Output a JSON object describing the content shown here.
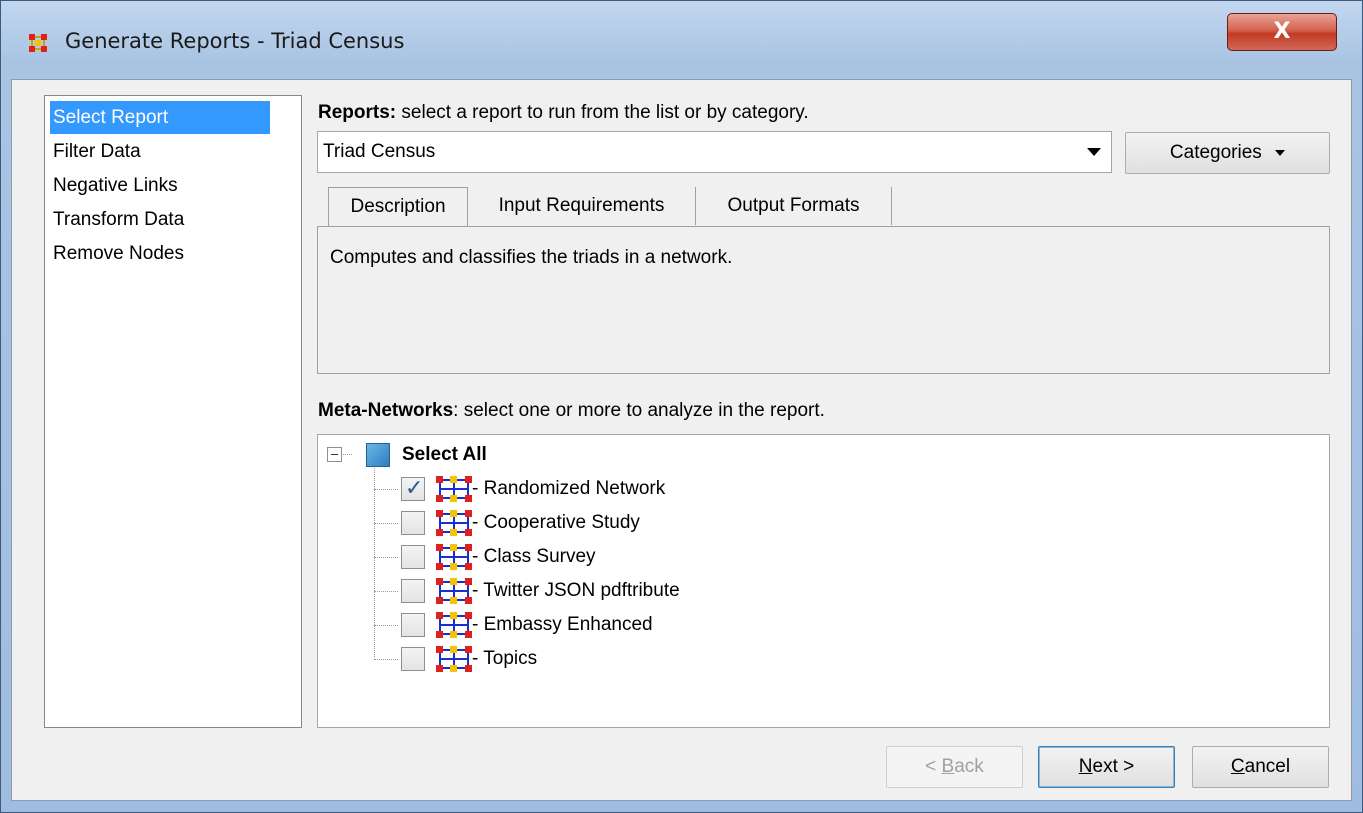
{
  "window": {
    "title": "Generate Reports - Triad Census",
    "close_label": "X"
  },
  "nav": {
    "items": [
      {
        "label": "Select Report",
        "selected": true
      },
      {
        "label": "Filter Data",
        "selected": false
      },
      {
        "label": "Negative Links",
        "selected": false
      },
      {
        "label": "Transform Data",
        "selected": false
      },
      {
        "label": "Remove Nodes",
        "selected": false
      }
    ]
  },
  "reports": {
    "heading_bold": "Reports:",
    "heading_rest": " select a report to run from the list or by category.",
    "selected_report": "Triad Census",
    "categories_label": "Categories"
  },
  "tabs": [
    {
      "label": "Description",
      "active": true
    },
    {
      "label": "Input Requirements",
      "active": false
    },
    {
      "label": "Output Formats",
      "active": false
    }
  ],
  "description_text": "Computes and classifies the triads in a network.",
  "meta_networks": {
    "heading_bold": "Meta-Networks",
    "heading_rest": ": select one or more to analyze in the report.",
    "select_all_label": "Select All",
    "items": [
      {
        "label": "- Randomized Network",
        "checked": true
      },
      {
        "label": "- Cooperative Study",
        "checked": false
      },
      {
        "label": "- Class Survey",
        "checked": false
      },
      {
        "label": "- Twitter JSON pdftribute",
        "checked": false
      },
      {
        "label": "- Embassy Enhanced",
        "checked": false
      },
      {
        "label": "- Topics",
        "checked": false
      }
    ]
  },
  "footer": {
    "back_prefix": "< ",
    "back_mnemonic": "B",
    "back_rest": "ack",
    "next_mnemonic": "N",
    "next_rest": "ext >",
    "cancel_mnemonic": "C",
    "cancel_rest": "ancel"
  },
  "colors": {
    "selection": "#3399ff",
    "titlebar": "#a9c4e3",
    "close_button": "#c23b22",
    "network_icon_node_red": "#e0201a",
    "network_icon_node_yellow": "#f5c400",
    "network_icon_link_blue": "#1a2fd0"
  }
}
